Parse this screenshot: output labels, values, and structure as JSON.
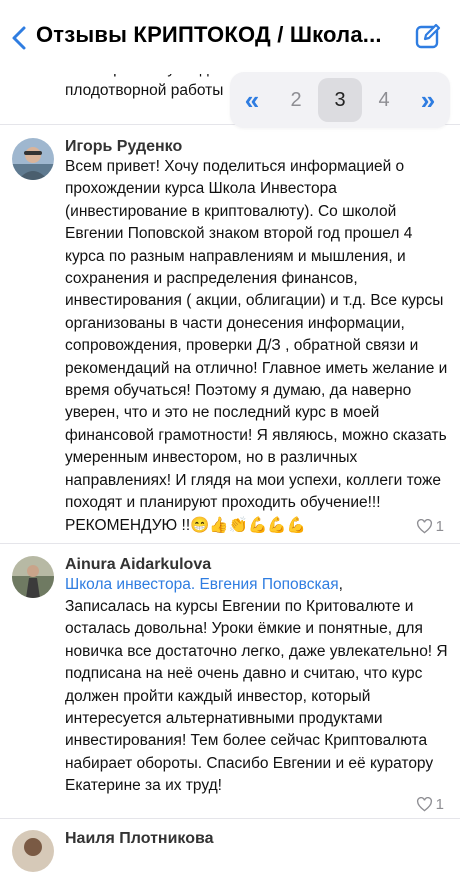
{
  "header": {
    "title": "Отзывы КРИПТОКОД /  Школа..."
  },
  "fragment": {
    "text": "благоприятно укладывалось в голове, удачи и плодотворной работы"
  },
  "pager": {
    "first": "«",
    "pages": [
      "2",
      "3",
      "4"
    ],
    "last": "»",
    "active": "3"
  },
  "comments": [
    {
      "author": "Игорь Руденко",
      "text": "Всем привет! Хочу поделиться информацией о прохождении курса Школа Инвестора (инвестирование в криптовалюту). Со школой Евгении Поповской знаком второй год прошел 4 курса по разным направлениям и мышления, и сохранения и распределения финансов, инвестирования ( акции, облигации) и т.д. Все курсы организованы в части донесения информации, сопровождения, проверки Д/З , обратной связи и рекомендаций на отлично! Главное иметь желание и время обучаться! Поэтому я думаю, да наверно уверен, что и это не последний курс в моей финансовой грамотности! Я являюсь, можно сказать умеренным инвестором, но в различных направлениях! И глядя на мои успехи, коллеги тоже походят и планируют проходить обучение!!! РЕКОМЕНДУЮ !!😁👍👏💪💪💪",
      "likes": "1"
    },
    {
      "author": "Ainura Aidarkulova",
      "mention": "Школа инвестора. Евгения Поповская",
      "mention_suffix": ",",
      "text": "Записалась на курсы Евгении по Критовалюте и осталась довольна! Уроки ёмкие и понятные, для новичка все достаточно легко, даже увлекательно! Я подписана на неё очень давно и считаю, что курс должен пройти каждый инвестор, который интересуется альтернативными продуктами инвестирования! Тем более сейчас Криптовалюта набирает обороты. Спасибо Евгении и её куратору Екатерине за их труд!",
      "likes": "1"
    },
    {
      "author": "Наиля Плотникова"
    }
  ],
  "icons": {
    "back": "chevron-left-icon",
    "compose": "compose-icon",
    "like": "heart-icon"
  },
  "colors": {
    "accent": "#2f7de1",
    "muted": "#8e8e93",
    "pager_bg": "#f2f2f5"
  }
}
